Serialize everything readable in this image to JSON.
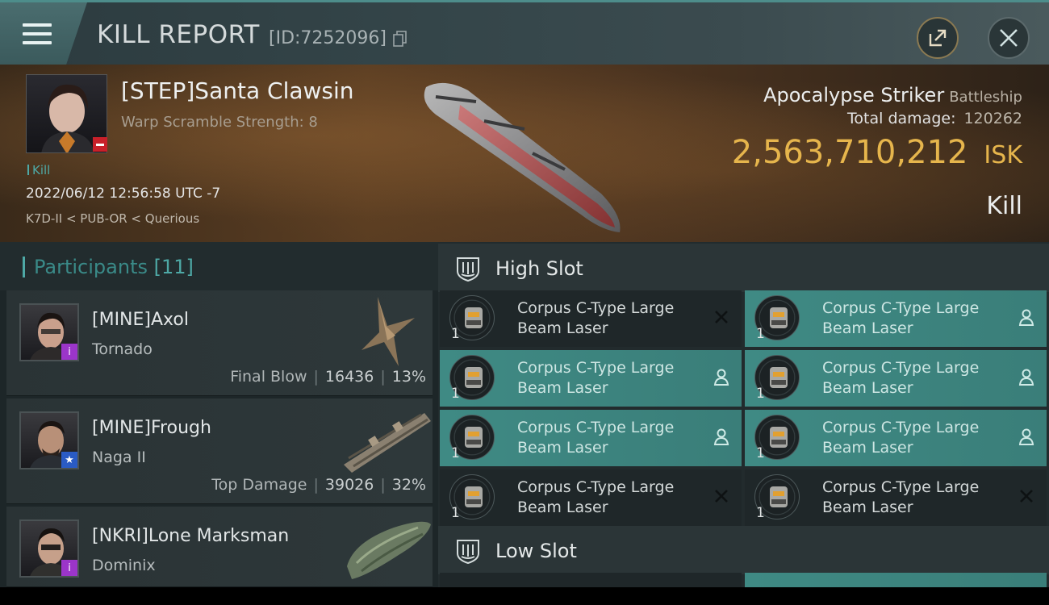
{
  "header": {
    "title": "KILL REPORT",
    "report_id": "[ID:7252096]"
  },
  "victim": {
    "name": "[STEP]Santa Clawsin",
    "subtitle": "Warp Scramble Strength: 8",
    "kill_tag": "Kill",
    "time": "2022/06/12 12:56:58 UTC -7",
    "location": "K7D-II < PUB-OR < Querious",
    "ship_name": "Apocalypse Striker",
    "ship_class": "Battleship",
    "total_damage_label": "Total damage:",
    "total_damage": "120262",
    "isk_value": "2,563,710,212",
    "isk_unit": "ISK",
    "result": "Kill"
  },
  "participants": {
    "title": "Participants",
    "count": "[11]",
    "rows": [
      {
        "name": "[MINE]Axol",
        "ship": "Tornado",
        "role": "Final Blow",
        "damage": "16436",
        "percent": "13%",
        "badge_color": "#9b35c9",
        "badge_glyph": "i"
      },
      {
        "name": "[MINE]Frough",
        "ship": "Naga II",
        "role": "Top Damage",
        "damage": "39026",
        "percent": "32%",
        "badge_color": "#2a5bc4",
        "badge_glyph": "★"
      },
      {
        "name": "[NKRI]Lone Marksman",
        "ship": "Dominix",
        "role": "",
        "damage": "",
        "percent": "",
        "badge_color": "#9b35c9",
        "badge_glyph": "i"
      }
    ]
  },
  "fitting": {
    "high_slot_label": "High Slot",
    "low_slot_label": "Low Slot",
    "high_slots": [
      {
        "qty": "1",
        "name_line1": "Corpus C-Type Large",
        "name_line2": "Beam Laser",
        "state": "destroyed"
      },
      {
        "qty": "1",
        "name_line1": "Corpus C-Type Large",
        "name_line2": "Beam Laser",
        "state": "dropped"
      },
      {
        "qty": "1",
        "name_line1": "Corpus C-Type Large",
        "name_line2": "Beam Laser",
        "state": "dropped"
      },
      {
        "qty": "1",
        "name_line1": "Corpus C-Type Large",
        "name_line2": "Beam Laser",
        "state": "dropped"
      },
      {
        "qty": "1",
        "name_line1": "Corpus C-Type Large",
        "name_line2": "Beam Laser",
        "state": "dropped"
      },
      {
        "qty": "1",
        "name_line1": "Corpus C-Type Large",
        "name_line2": "Beam Laser",
        "state": "dropped"
      },
      {
        "qty": "1",
        "name_line1": "Corpus C-Type Large",
        "name_line2": "Beam Laser",
        "state": "destroyed"
      },
      {
        "qty": "1",
        "name_line1": "Corpus C-Type Large",
        "name_line2": "Beam Laser",
        "state": "destroyed"
      }
    ]
  },
  "icons": {
    "menu": "hamburger-menu-icon",
    "copy": "copy-icon",
    "share": "share-icon",
    "close": "close-icon",
    "slot": "slot-shield-icon",
    "dropped": "person-icon",
    "destroyed": "cross-icon"
  },
  "colors": {
    "accent": "#4ea9a6",
    "isk": "#e6b54c",
    "module_dropped_bg": "#3f8a84",
    "module_destroyed_bg": "#1f2729"
  }
}
